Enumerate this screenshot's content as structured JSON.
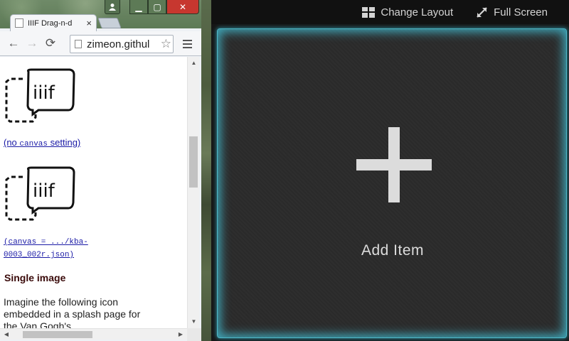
{
  "browser": {
    "tab_title": "IIIF Drag-n-d",
    "tab_close": "×",
    "url": "zimeon.githul",
    "star": "☆",
    "nav": {
      "back": "←",
      "forward": "→",
      "reload": "⟳"
    },
    "window_controls": {
      "min": "▁",
      "max": "▢",
      "close": "✕"
    },
    "icons": {
      "user": "user-icon",
      "favicon": "page-icon",
      "menu": "hamburger-menu-icon"
    },
    "content": {
      "logo_text": "iiif",
      "link1_prefix": "(no ",
      "link1_code": "canvas",
      "link1_suffix": " setting)",
      "link2_line1": "(canvas = .../kba-",
      "link2_line2": "0003_002r.json)",
      "heading": "Single image",
      "paragraph": "Imagine the following icon embedded in a splash page for the Van Gogh's"
    },
    "scroll": {
      "up": "▲",
      "down": "▼",
      "left": "◀",
      "right": "▶"
    }
  },
  "app": {
    "change_layout": "Change Layout",
    "full_screen": "Full Screen",
    "add_item": "Add Item",
    "accent_color": "#3fa6b8",
    "icons": {
      "change_layout": "grid-layout-icon",
      "full_screen": "expand-arrows-icon",
      "add": "plus-icon"
    }
  }
}
